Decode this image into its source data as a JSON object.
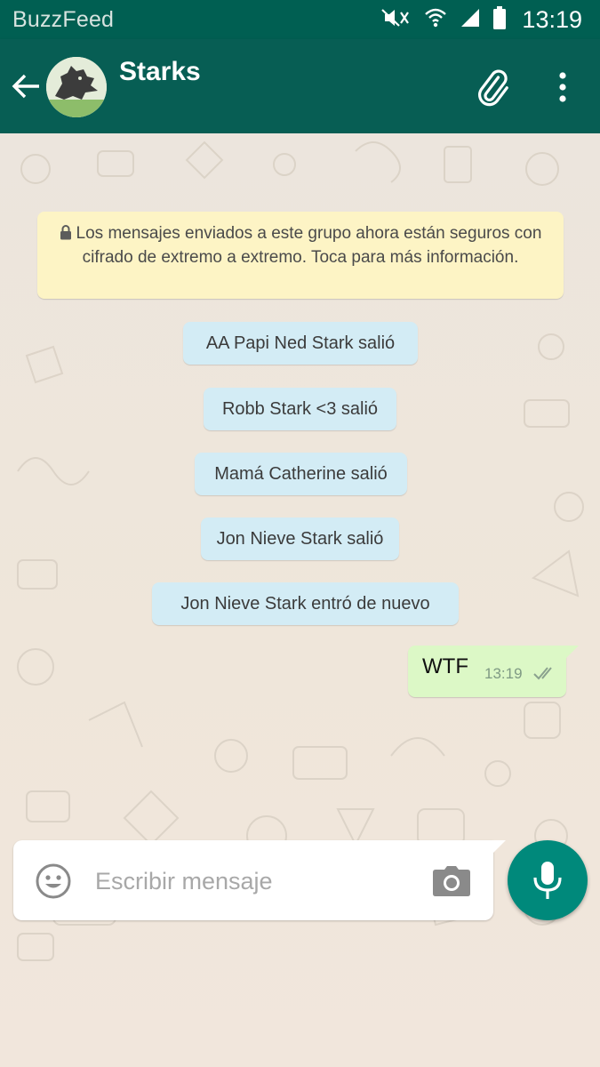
{
  "status_bar": {
    "brand": "BuzzFeed",
    "time": "13:19",
    "icons": [
      "mute-icon",
      "wifi-icon",
      "signal-icon",
      "battery-icon"
    ]
  },
  "header": {
    "title": "Starks",
    "icons": [
      "back-arrow-icon",
      "group-avatar",
      "paperclip-icon",
      "more-options-icon"
    ]
  },
  "encryption_notice": {
    "icon": "lock-icon",
    "text": "Los mensajes enviados a este grupo ahora están seguros con cifrado de extremo a extremo. Toca para más información."
  },
  "system_messages": [
    "AA Papi Ned Stark salió",
    "Robb Stark <3 salió",
    "Mamá Catherine salió",
    "Jon Nieve Stark salió",
    "Jon Nieve Stark entró de nuevo"
  ],
  "outgoing_message": {
    "text": "WTF",
    "time": "13:19",
    "status_icon": "double-check-icon"
  },
  "composer": {
    "placeholder": "Escribir mensaje",
    "icons": [
      "emoji-icon",
      "camera-icon",
      "mic-icon"
    ]
  },
  "colors": {
    "status_bar": "#005f52",
    "app_bar": "#075e54",
    "notice_background": "#fdf4c5",
    "system_bubble": "#d3ecf5",
    "outgoing_bubble": "#dcf8c6",
    "mic_button": "#00897b"
  }
}
